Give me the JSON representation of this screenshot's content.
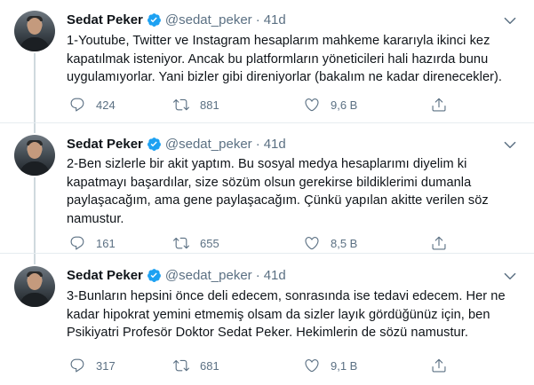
{
  "tweets": [
    {
      "name": "Sedat Peker",
      "handle": "@sedat_peker",
      "dot": "·",
      "time": "41d",
      "lines": [
        "1-Youtube, Twitter ve Instagram hesaplarım mahkeme kararıyla ikinci kez",
        "kapatılmak isteniyor. Ancak bu platformların yöneticileri hali hazırda bunu",
        "uygulamıyorlar. Yani bizler gibi direniyorlar (bakalım ne kadar direnecekler)."
      ],
      "replies": "424",
      "retweets": "881",
      "likes": "9,6 B"
    },
    {
      "name": "Sedat Peker",
      "handle": "@sedat_peker",
      "dot": "·",
      "time": "41d",
      "lines": [
        "2-Ben sizlerle bir akit yaptım. Bu sosyal medya hesaplarımı diyelim ki",
        "kapatmayı başardılar, size sözüm olsun gerekirse bildiklerimi dumanla",
        "paylaşacağım, ama gene paylaşacağım. Çünkü yapılan akitte verilen söz",
        "namustur."
      ],
      "replies": "161",
      "retweets": "655",
      "likes": "8,5 B"
    },
    {
      "name": "Sedat Peker",
      "handle": "@sedat_peker",
      "dot": "·",
      "time": "41d",
      "lines": [
        "3-Bunların hepsini önce deli edecem, sonrasında ise tedavi edecem. Her ne",
        "kadar hipokrat yemini etmemiş olsam da sizler layık gördüğünüz için, ben",
        "Psikiyatri Profesör Doktor Sedat Peker. Hekimlerin de sözü namustur."
      ],
      "replies": "317",
      "retweets": "681",
      "likes": "9,1 B"
    }
  ],
  "icons": {
    "verified": "verified-badge-icon",
    "caret": "chevron-down-icon",
    "reply": "reply-icon",
    "retweet": "retweet-icon",
    "like": "heart-icon",
    "share": "share-icon"
  },
  "colors": {
    "verified": "#1da1f2",
    "text": "#0f1419",
    "secondary": "#5b7083",
    "thread_line": "#cfd9de",
    "separator": "#e6ecf0"
  }
}
